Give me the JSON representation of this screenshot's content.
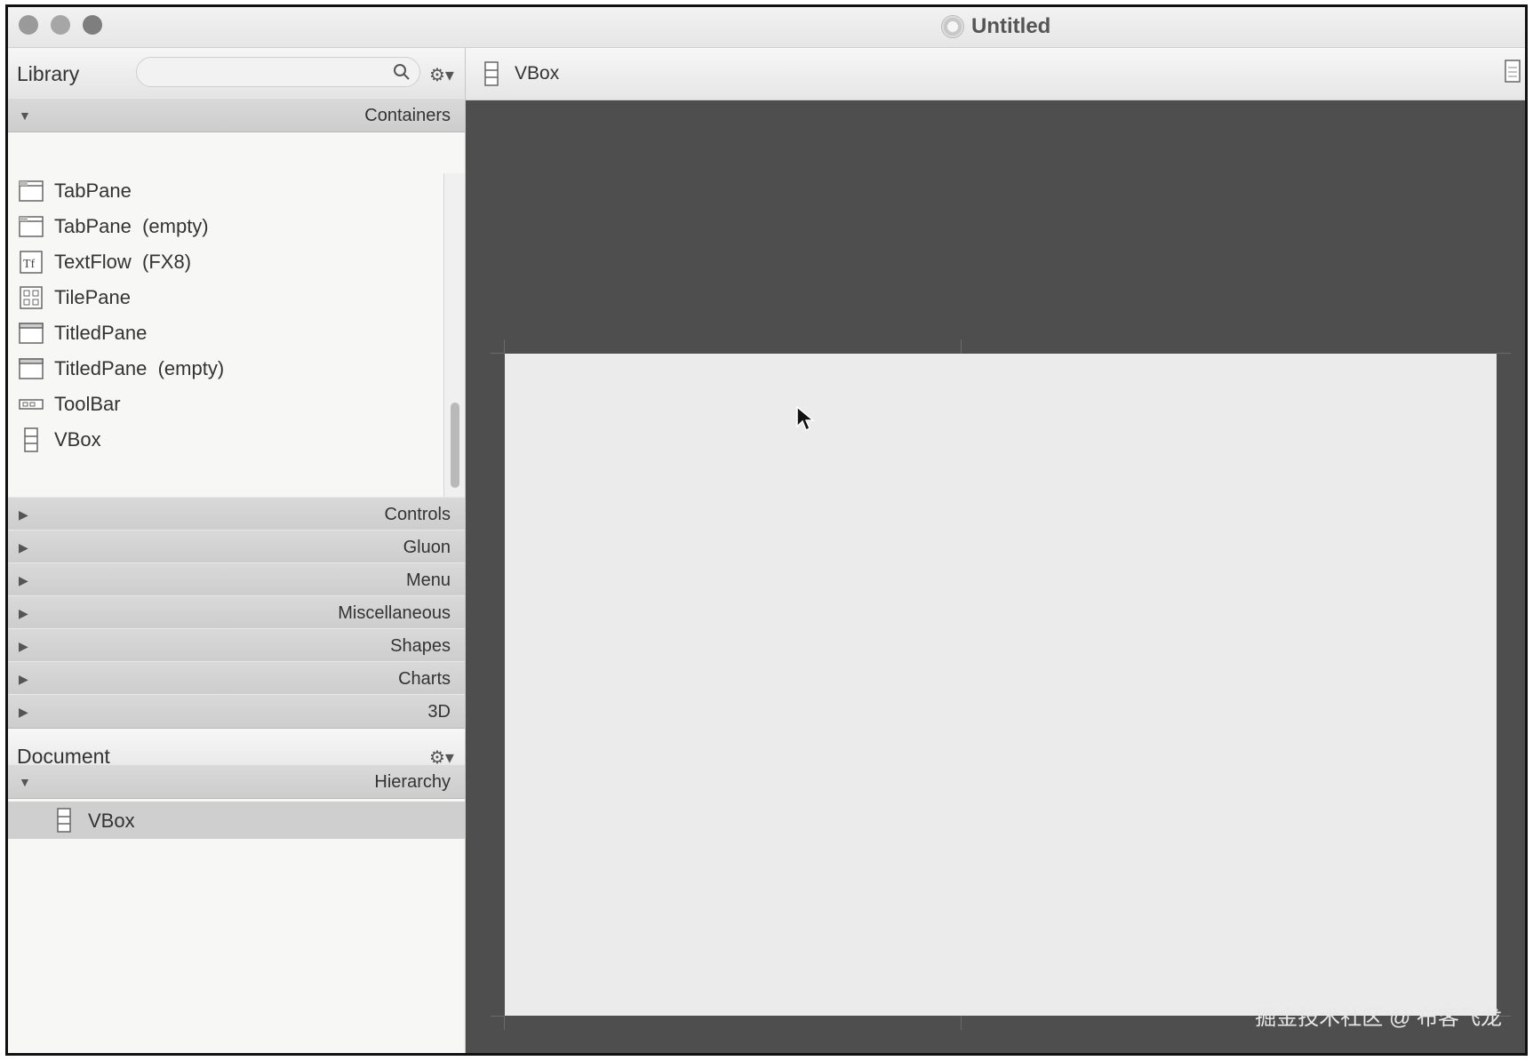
{
  "window": {
    "title": "Untitled"
  },
  "library": {
    "title": "Library",
    "search_placeholder": "",
    "sections_open": {
      "label": "Containers"
    },
    "items": [
      {
        "label": "TabPane",
        "icon": "tabpane-icon"
      },
      {
        "label": "TabPane  (empty)",
        "icon": "tabpane-icon"
      },
      {
        "label": "TextFlow  (FX8)",
        "icon": "textflow-icon"
      },
      {
        "label": "TilePane",
        "icon": "tilepane-icon"
      },
      {
        "label": "TitledPane",
        "icon": "titledpane-icon"
      },
      {
        "label": "TitledPane  (empty)",
        "icon": "titledpane-icon"
      },
      {
        "label": "ToolBar",
        "icon": "toolbar-icon"
      },
      {
        "label": "VBox",
        "icon": "vbox-icon"
      }
    ],
    "collapsed_sections": [
      {
        "label": "Controls"
      },
      {
        "label": "Gluon"
      },
      {
        "label": "Menu"
      },
      {
        "label": "Miscellaneous"
      },
      {
        "label": "Shapes"
      },
      {
        "label": "Charts"
      },
      {
        "label": "3D"
      }
    ]
  },
  "document": {
    "title": "Document",
    "section": {
      "label": "Hierarchy"
    },
    "rows": [
      {
        "label": "VBox"
      }
    ]
  },
  "editor": {
    "breadcrumb": "VBox",
    "watermark": "掘金技术社区 @ 布客飞龙"
  },
  "colors": {
    "canvas_bg": "#4e4e4e",
    "stage_bg": "#ebebeb",
    "selected_row": "#cfcfcf"
  }
}
